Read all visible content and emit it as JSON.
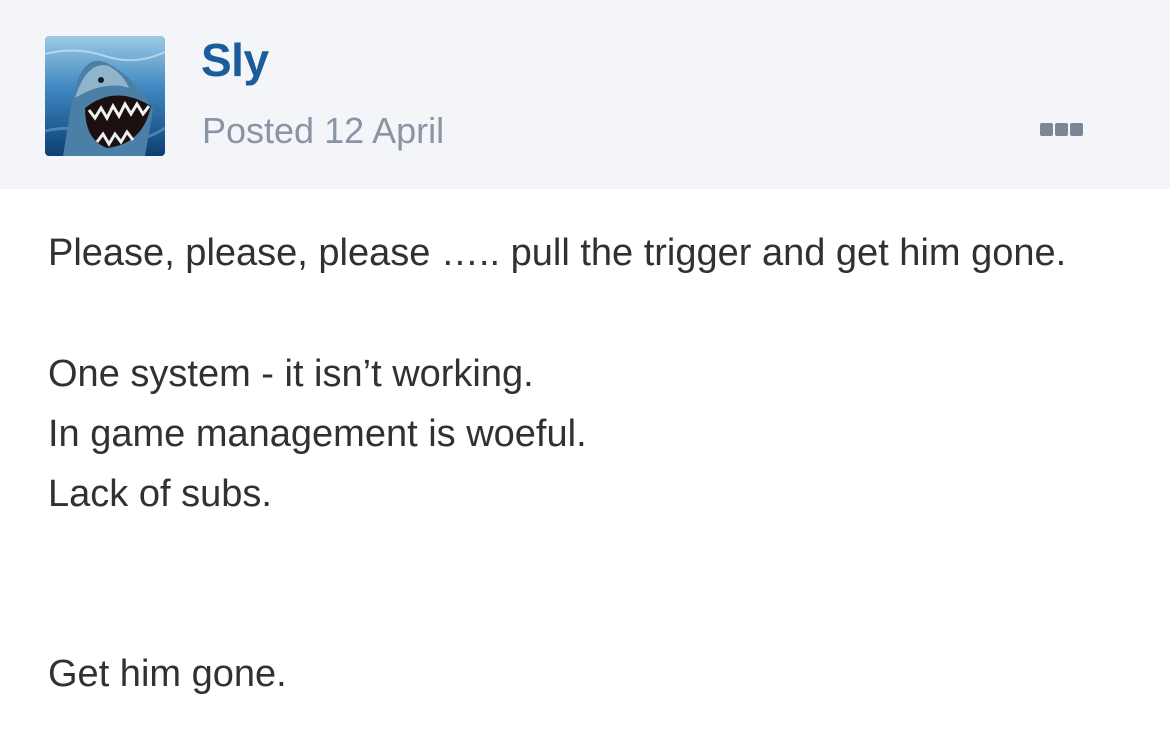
{
  "post": {
    "author": "Sly",
    "date": "Posted 12 April",
    "avatar_icon": "shark-avatar",
    "more_icon": "more-dots-icon",
    "body_lines": [
      "Please, please, please ….. pull the trigger and get him gone.",
      "One system - it isn’t working.",
      "In game management is woeful.",
      "Lack of subs.",
      "Get him gone."
    ]
  },
  "colors": {
    "header_bg": "#f3f5f8",
    "author": "#1b5d9b",
    "date": "#8a94a4",
    "body_text": "#2f3133",
    "dots": "#7d8696"
  }
}
